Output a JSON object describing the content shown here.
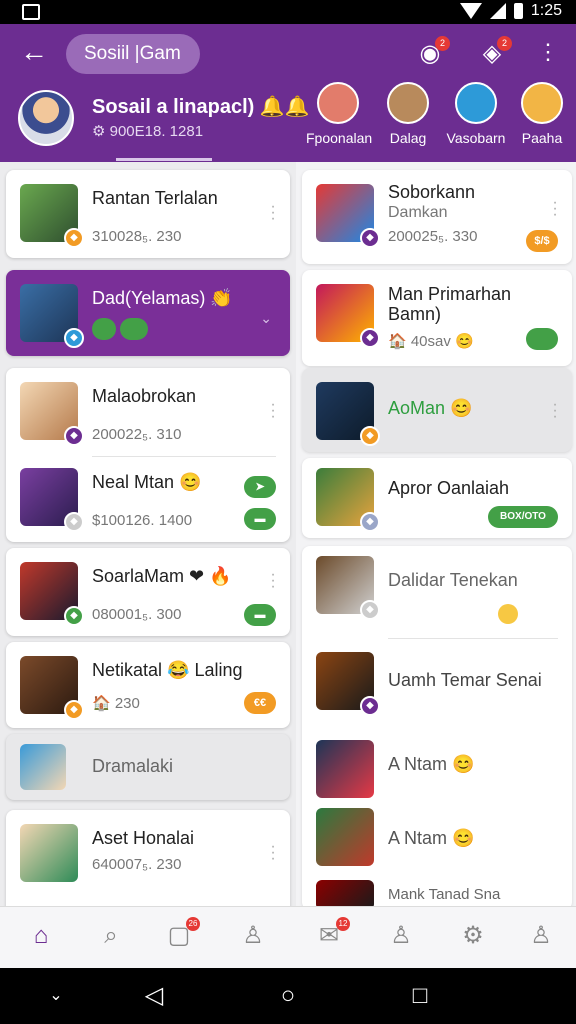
{
  "status_bar": {
    "time": "1:25"
  },
  "header": {
    "search_text": "Sosiil |Gam",
    "badges": [
      "2",
      "2"
    ],
    "profile_name": "Sosail a linapacl) 🔔🔔",
    "profile_sub": "⚙ 900E18. 1281",
    "stories": [
      {
        "label": "Fpoonalan",
        "color": "#e27c6b"
      },
      {
        "label": "Dalag",
        "color": "#b88a5c"
      },
      {
        "label": "Vasobarn",
        "color": "#2d9ad8"
      },
      {
        "label": "Paaha",
        "color": "#f2b545"
      }
    ]
  },
  "left": [
    {
      "title": "Rantan Terlalan",
      "sub": "310028₅. 230",
      "state": "normal"
    },
    {
      "title": "Dad(Yelamas) 👏",
      "sub": "",
      "state": "active"
    },
    {
      "title": "Malaobrokan",
      "sub": "200022₅. 310",
      "state": "normal"
    },
    {
      "title": "Neal Mtan 😊",
      "sub": "$100126. 1400",
      "state": "normal"
    },
    {
      "title": "SoarlaMam ❤ 🔥",
      "sub": "080001₅. 300",
      "state": "normal"
    },
    {
      "title": "Netikatal 😂 Laling",
      "sub": "🏠 230",
      "state": "normal"
    },
    {
      "title": "Dramalaki",
      "sub": "",
      "state": "gray"
    },
    {
      "title": "Aset Honalai",
      "sub": "640007₅. 230",
      "state": "normal"
    }
  ],
  "right": [
    {
      "title": "Soborkann",
      "title2": "Damkan",
      "sub": "200025₅. 330"
    },
    {
      "title": "Man Primarhan",
      "title2": "Bamn)",
      "sub": "🏠 40sav 😊"
    },
    {
      "title": "AoMan 😊",
      "title2": "",
      "sub": ""
    },
    {
      "title": "Apror Oanlaiah",
      "title2": "",
      "sub": ""
    },
    {
      "title": "Dalidar Tenekan",
      "title2": "",
      "sub": ""
    },
    {
      "title": "Uamh Temar Senai",
      "title2": "",
      "sub": ""
    },
    {
      "title": "A Ntam 😊",
      "title2": "",
      "sub": ""
    },
    {
      "title": "A Ntam 😊",
      "title2": "",
      "sub": ""
    },
    {
      "title": "Mank Tanad Sna",
      "title2": "",
      "sub": ""
    }
  ],
  "pills": {
    "o1": "$/$",
    "g1": "➤",
    "g2": "▬",
    "g3": "▬",
    "o2": "€€",
    "g4": "BOX/OTO"
  },
  "bottom_badges": [
    "26",
    "12"
  ]
}
